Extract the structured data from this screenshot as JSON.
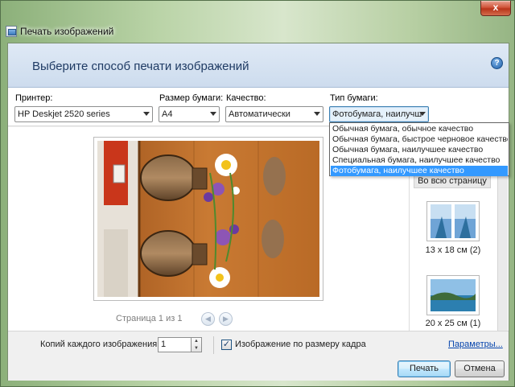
{
  "window": {
    "title": "Печать изображений",
    "close_glyph": "x"
  },
  "header": {
    "title": "Выберите способ печати изображений"
  },
  "options": {
    "printer_label": "Принтер:",
    "printer_value": "HP Deskjet 2520 series",
    "paper_size_label": "Размер бумаги:",
    "paper_size_value": "A4",
    "quality_label": "Качество:",
    "quality_value": "Автоматически",
    "paper_type_label": "Тип бумаги:",
    "paper_type_value": "Фотобумага, наилучш",
    "help_glyph": "?"
  },
  "paper_type_dropdown": {
    "items": [
      "Обычная бумага, обычное качество",
      "Обычная бумага, быстрое черновое качество",
      "Обычная бумага, наилучшее качество",
      "Специальная бумага, наилучшее качество",
      "Фотобумага, наилучшее качество"
    ],
    "selected_index": 4
  },
  "preview": {
    "page_info": "Страница 1 из 1",
    "prev_glyph": "◀",
    "next_glyph": "▶"
  },
  "layouts": {
    "full_page_label": "Во всю страницу",
    "items": [
      {
        "caption": "13 x 18 см (2)"
      },
      {
        "caption": "20 x 25 см (1)"
      }
    ]
  },
  "bottom": {
    "copies_label": "Копий каждого изображения:",
    "copies_value": "1",
    "fit_checked": true,
    "fit_check_glyph": "✓",
    "fit_label": "Изображение по размеру кадра",
    "params_link": "Параметры..."
  },
  "buttons": {
    "print": "Печать",
    "cancel": "Отмена"
  },
  "colors": {
    "accent": "#3399ff",
    "header_title": "#1f3b64",
    "link": "#0645ad"
  }
}
